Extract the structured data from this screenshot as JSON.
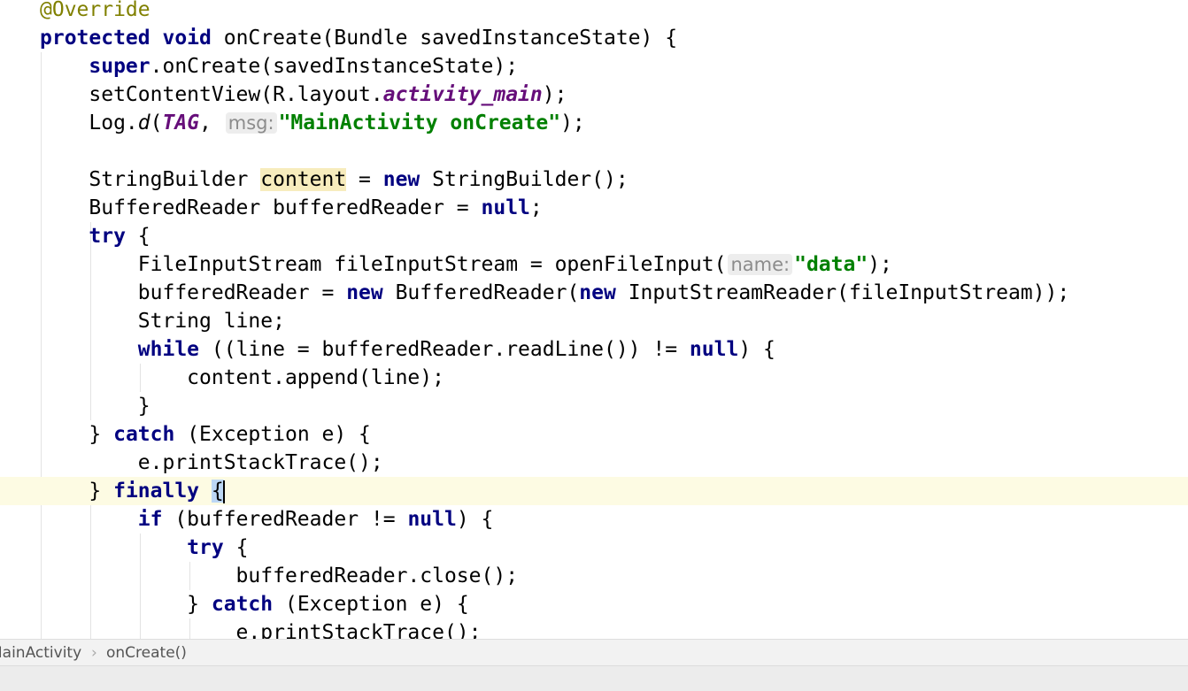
{
  "editor": {
    "language": "java",
    "current_line": 17,
    "lines": [
      [
        {
          "t": "@Override",
          "c": "ann"
        }
      ],
      [
        {
          "t": "protected",
          "c": "kw"
        },
        {
          "t": " "
        },
        {
          "t": "void",
          "c": "kw"
        },
        {
          "t": " onCreate(Bundle savedInstanceState) {"
        }
      ],
      [
        {
          "t": "    "
        },
        {
          "t": "super",
          "c": "kw"
        },
        {
          "t": ".onCreate(savedInstanceState);"
        }
      ],
      [
        {
          "t": "    setContentView(R.layout."
        },
        {
          "t": "activity_main",
          "c": "st"
        },
        {
          "t": ");"
        }
      ],
      [
        {
          "t": "    Log."
        },
        {
          "t": "d",
          "c": "m"
        },
        {
          "t": "("
        },
        {
          "t": "TAG",
          "c": "st"
        },
        {
          "t": ", "
        },
        {
          "t": "msg:",
          "c": "hint"
        },
        {
          "t": "\"MainActivity onCreate\"",
          "c": "str"
        },
        {
          "t": ");"
        }
      ],
      [
        {
          "t": ""
        }
      ],
      [
        {
          "t": "    StringBuilder "
        },
        {
          "t": "content",
          "c": "hl"
        },
        {
          "t": " = "
        },
        {
          "t": "new",
          "c": "kw"
        },
        {
          "t": " StringBuilder();"
        }
      ],
      [
        {
          "t": "    BufferedReader bufferedReader = "
        },
        {
          "t": "null",
          "c": "kw"
        },
        {
          "t": ";"
        }
      ],
      [
        {
          "t": "    "
        },
        {
          "t": "try",
          "c": "kw"
        },
        {
          "t": " {"
        }
      ],
      [
        {
          "t": "        FileInputStream fileInputStream = openFileInput("
        },
        {
          "t": "name:",
          "c": "hint"
        },
        {
          "t": "\"data\"",
          "c": "str"
        },
        {
          "t": ");"
        }
      ],
      [
        {
          "t": "        bufferedReader = "
        },
        {
          "t": "new",
          "c": "kw"
        },
        {
          "t": " BufferedReader("
        },
        {
          "t": "new",
          "c": "kw"
        },
        {
          "t": " InputStreamReader(fileInputStream));"
        }
      ],
      [
        {
          "t": "        String line;"
        }
      ],
      [
        {
          "t": "        "
        },
        {
          "t": "while",
          "c": "kw"
        },
        {
          "t": " ((line = bufferedReader.readLine()) != "
        },
        {
          "t": "null",
          "c": "kw"
        },
        {
          "t": ") {"
        }
      ],
      [
        {
          "t": "            content.append(line);"
        }
      ],
      [
        {
          "t": "        }"
        }
      ],
      [
        {
          "t": "    } "
        },
        {
          "t": "catch",
          "c": "kw"
        },
        {
          "t": " (Exception e) {"
        }
      ],
      [
        {
          "t": "        e.printStackTrace();"
        }
      ],
      [
        {
          "t": "    } "
        },
        {
          "t": "finally",
          "c": "kw"
        },
        {
          "t": " "
        },
        {
          "t": "{",
          "c": "brace"
        },
        {
          "t": "",
          "c": "caret"
        }
      ],
      [
        {
          "t": "        "
        },
        {
          "t": "if",
          "c": "kw"
        },
        {
          "t": " (bufferedReader != "
        },
        {
          "t": "null",
          "c": "kw"
        },
        {
          "t": ") {"
        }
      ],
      [
        {
          "t": "            "
        },
        {
          "t": "try",
          "c": "kw"
        },
        {
          "t": " {"
        }
      ],
      [
        {
          "t": "                bufferedReader.close();"
        }
      ],
      [
        {
          "t": "            } "
        },
        {
          "t": "catch",
          "c": "kw"
        },
        {
          "t": " (Exception e) {"
        }
      ],
      [
        {
          "t": "                e.printStackTrace();"
        }
      ]
    ]
  },
  "breadcrumb": {
    "items": [
      "MainActivity",
      "onCreate()"
    ],
    "separator": "›"
  }
}
